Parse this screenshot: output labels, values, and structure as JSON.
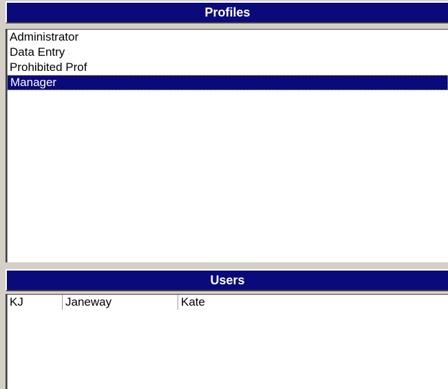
{
  "profiles": {
    "header": "Profiles",
    "items": [
      {
        "label": "Administrator",
        "selected": false
      },
      {
        "label": "Data Entry",
        "selected": false
      },
      {
        "label": "Prohibited Prof",
        "selected": false
      },
      {
        "label": "Manager",
        "selected": true
      }
    ]
  },
  "users": {
    "header": "Users",
    "rows": [
      {
        "initials": "KJ",
        "last_name": "Janeway",
        "first_name": "Kate"
      }
    ]
  },
  "colors": {
    "header_bg": "#0a0a7a",
    "selection_bg": "#0a0a7a",
    "window_bg": "#d4d0c8"
  }
}
